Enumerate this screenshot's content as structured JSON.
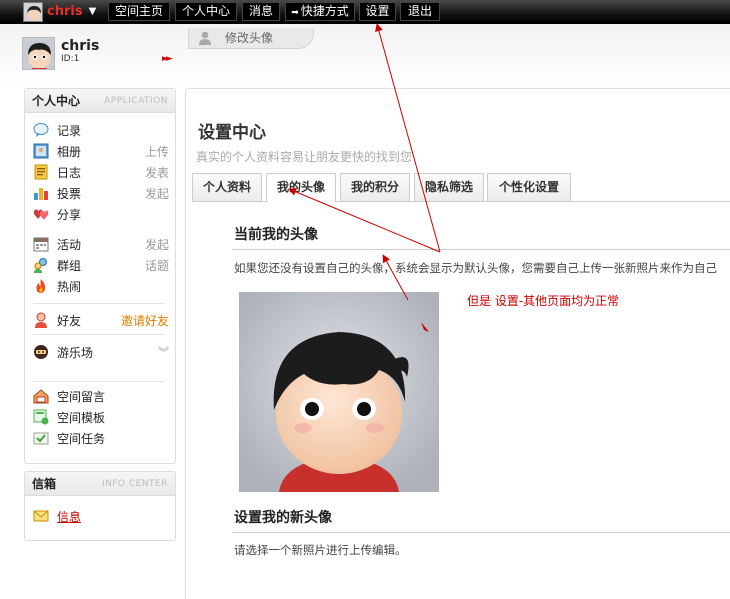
{
  "topbar": {
    "username": "chris",
    "nav": [
      "空间主页",
      "个人中心",
      "消息",
      "快捷方式",
      "设置",
      "退出"
    ]
  },
  "profile": {
    "name": "chris",
    "id_label": "ID:1",
    "edit_avatar_label": "修改头像"
  },
  "sidebar": {
    "title": "个人中心",
    "subtitle": "APPLICATION",
    "items": [
      {
        "label": "记录",
        "right": "",
        "icon": "speech-bubble-icon"
      },
      {
        "label": "相册",
        "right": "上传",
        "icon": "photo-icon"
      },
      {
        "label": "日志",
        "right": "发表",
        "icon": "notepad-icon"
      },
      {
        "label": "投票",
        "right": "发起",
        "icon": "bar-chart-icon"
      },
      {
        "label": "分享",
        "right": "",
        "icon": "hearts-icon"
      },
      {
        "label": "活动",
        "right": "发起",
        "icon": "calendar-icon"
      },
      {
        "label": "群组",
        "right": "话题",
        "icon": "group-icon"
      },
      {
        "label": "热闹",
        "right": "",
        "icon": "fire-icon"
      },
      {
        "label": "好友",
        "right": "邀请好友",
        "icon": "friend-icon"
      },
      {
        "label": "游乐场",
        "right": "",
        "icon": "game-icon"
      },
      {
        "label": "空间留言",
        "right": "",
        "icon": "house-message-icon"
      },
      {
        "label": "空间模板",
        "right": "",
        "icon": "template-icon"
      },
      {
        "label": "空间任务",
        "right": "",
        "icon": "task-icon"
      }
    ]
  },
  "mailbox": {
    "title": "信箱",
    "subtitle": "INFO CENTER",
    "link": "信息"
  },
  "main": {
    "title": "设置中心",
    "subtitle": "真实的个人资料容易让朋友更快的找到您",
    "tabs": [
      "个人资料",
      "我的头像",
      "我的积分",
      "隐私筛选",
      "个性化设置"
    ],
    "current_avatar_title": "当前我的头像",
    "current_avatar_desc": "如果您还没有设置自己的头像，系统会显示为默认头像，您需要自己上传一张新照片来作为自己",
    "annotation": "但是 设置-其他页面均为正常",
    "new_avatar_title": "设置我的新头像",
    "new_avatar_desc": "请选择一个新照片进行上传编辑。"
  },
  "colors": {
    "username_red": "#e4302b",
    "annotation_red": "#cc0000",
    "invite_orange": "#e07b00"
  }
}
